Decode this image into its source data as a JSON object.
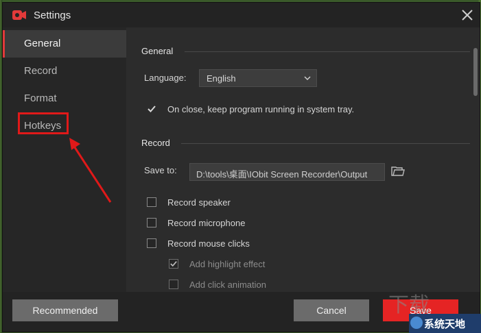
{
  "window": {
    "title": "Settings"
  },
  "sidebar": {
    "items": [
      {
        "label": "General",
        "active": true
      },
      {
        "label": "Record",
        "active": false
      },
      {
        "label": "Format",
        "active": false
      },
      {
        "label": "Hotkeys",
        "active": false,
        "highlighted": true
      }
    ]
  },
  "general": {
    "title": "General",
    "language_label": "Language:",
    "language_value": "English",
    "keep_running_label": "On close, keep program running in system tray.",
    "keep_running_checked": true
  },
  "record": {
    "title": "Record",
    "save_to_label": "Save to:",
    "save_to_value": "D:\\tools\\桌面\\IObit Screen Recorder\\Output",
    "options": [
      {
        "label": "Record speaker",
        "checked": false,
        "enabled": true
      },
      {
        "label": "Record microphone",
        "checked": false,
        "enabled": true
      },
      {
        "label": "Record mouse clicks",
        "checked": false,
        "enabled": true
      },
      {
        "label": "Add highlight effect",
        "checked": true,
        "enabled": false
      },
      {
        "label": "Add click animation",
        "checked": false,
        "enabled": false
      }
    ]
  },
  "footer": {
    "recommended_label": "Recommended",
    "cancel_label": "Cancel",
    "save_label": "Save"
  },
  "watermark": {
    "text": "系统天地"
  },
  "colors": {
    "accent": "#e52424",
    "highlight_box": "#e01919",
    "background": "#232323",
    "panel": "#2c2c2c"
  }
}
